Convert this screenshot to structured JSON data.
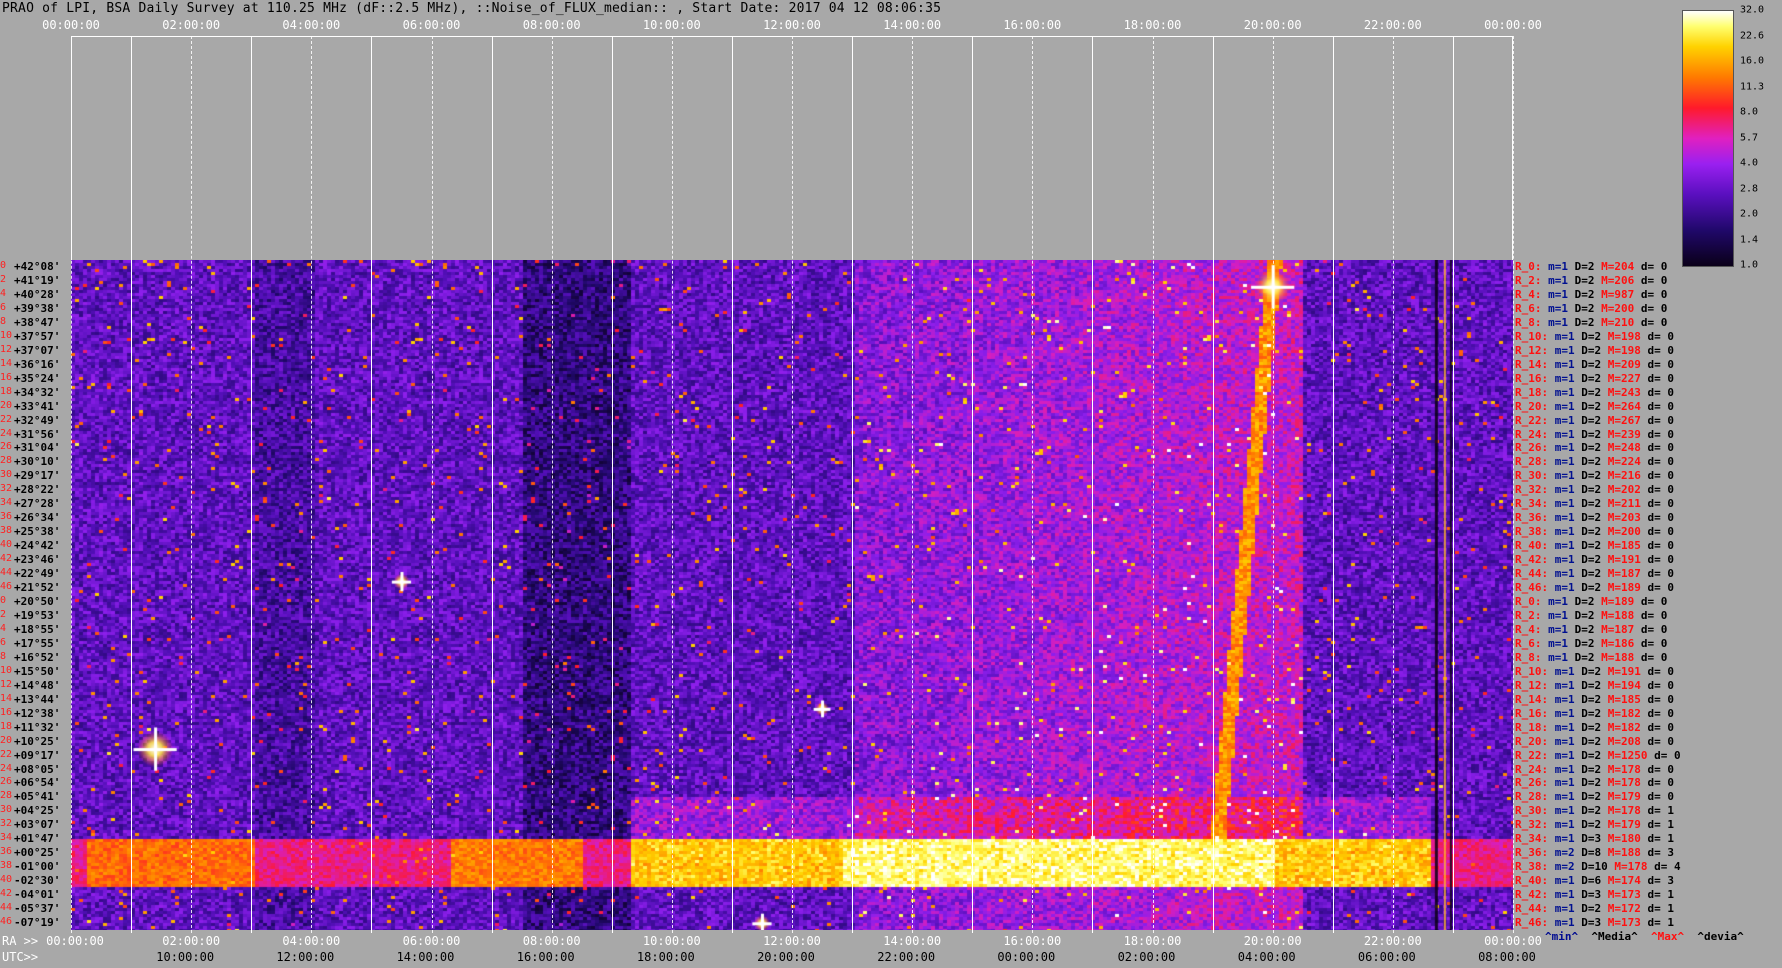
{
  "title": "PRAO of LPI, BSA Daily Survey at 110.25 MHz (dF::2.5 MHz), ::Noise_of_FLUX_median:: , Start Date: 2017 04 12 08:06:35",
  "top_ticks": [
    "00:00:00",
    "02:00:00",
    "04:00:00",
    "06:00:00",
    "08:00:00",
    "10:00:00",
    "12:00:00",
    "14:00:00",
    "16:00:00",
    "18:00:00",
    "20:00:00",
    "22:00:00",
    "00:00:00"
  ],
  "colorbar": {
    "ticks": [
      "32.0",
      "22.6",
      "16.0",
      "11.3",
      "8.0",
      "5.7",
      "4.0",
      "2.8",
      "2.0",
      "1.4",
      "1.0"
    ],
    "colors": [
      "#0a0018",
      "#20086a",
      "#5a0fbf",
      "#9a20f0",
      "#e020c0",
      "#ff1a2a",
      "#ff7a00",
      "#ffd200",
      "#ffff70",
      "#ffffff"
    ]
  },
  "row_index": [
    "0",
    "2",
    "4",
    "6",
    "8",
    "10",
    "12",
    "14",
    "16",
    "18",
    "20",
    "22",
    "24",
    "26",
    "28",
    "30",
    "32",
    "34",
    "36",
    "38",
    "40",
    "42",
    "44",
    "46",
    "0",
    "2",
    "4",
    "6",
    "8",
    "10",
    "12",
    "14",
    "16",
    "18",
    "20",
    "22",
    "24",
    "26",
    "28",
    "30",
    "32",
    "34",
    "36",
    "38",
    "40",
    "42",
    "44",
    "46"
  ],
  "declinations": [
    "+42°08'",
    "+41°19'",
    "+40°28'",
    "+39°38'",
    "+38°47'",
    "+37°57'",
    "+37°07'",
    "+36°16'",
    "+35°24'",
    "+34°32'",
    "+33°41'",
    "+32°49'",
    "+31°56'",
    "+31°04'",
    "+30°10'",
    "+29°17'",
    "+28°22'",
    "+27°28'",
    "+26°34'",
    "+25°38'",
    "+24°42'",
    "+23°46'",
    "+22°49'",
    "+21°52'",
    "+20°50'",
    "+19°53'",
    "+18°55'",
    "+17°55'",
    "+16°52'",
    "+15°50'",
    "+14°48'",
    "+13°44'",
    "+12°38'",
    "+11°32'",
    "+10°25'",
    "+09°17'",
    "+08°05'",
    "+06°54'",
    "+05°41'",
    "+04°25'",
    "+03°07'",
    "+01°47'",
    "+00°25'",
    "-01°00'",
    "-02°30'",
    "-04°01'",
    "-05°37'",
    "-07°19'"
  ],
  "right_labels": [
    {
      "r": "R_0:",
      "m": "m=1",
      "D": "D=2",
      "M": "M=204",
      "d": "d= 0"
    },
    {
      "r": "R_2:",
      "m": "m=1",
      "D": "D=2",
      "M": "M=206",
      "d": "d= 0"
    },
    {
      "r": "R_4:",
      "m": "m=1",
      "D": "D=2",
      "M": "M=987",
      "d": "d= 0"
    },
    {
      "r": "R_6:",
      "m": "m=1",
      "D": "D=2",
      "M": "M=200",
      "d": "d= 0"
    },
    {
      "r": "R_8:",
      "m": "m=1",
      "D": "D=2",
      "M": "M=210",
      "d": "d= 0"
    },
    {
      "r": "R_10:",
      "m": "m=1",
      "D": "D=2",
      "M": "M=198",
      "d": "d= 0"
    },
    {
      "r": "R_12:",
      "m": "m=1",
      "D": "D=2",
      "M": "M=198",
      "d": "d= 0"
    },
    {
      "r": "R_14:",
      "m": "m=1",
      "D": "D=2",
      "M": "M=209",
      "d": "d= 0"
    },
    {
      "r": "R_16:",
      "m": "m=1",
      "D": "D=2",
      "M": "M=227",
      "d": "d= 0"
    },
    {
      "r": "R_18:",
      "m": "m=1",
      "D": "D=2",
      "M": "M=243",
      "d": "d= 0"
    },
    {
      "r": "R_20:",
      "m": "m=1",
      "D": "D=2",
      "M": "M=264",
      "d": "d= 0"
    },
    {
      "r": "R_22:",
      "m": "m=1",
      "D": "D=2",
      "M": "M=267",
      "d": "d= 0"
    },
    {
      "r": "R_24:",
      "m": "m=1",
      "D": "D=2",
      "M": "M=239",
      "d": "d= 0"
    },
    {
      "r": "R_26:",
      "m": "m=1",
      "D": "D=2",
      "M": "M=248",
      "d": "d= 0"
    },
    {
      "r": "R_28:",
      "m": "m=1",
      "D": "D=2",
      "M": "M=224",
      "d": "d= 0"
    },
    {
      "r": "R_30:",
      "m": "m=1",
      "D": "D=2",
      "M": "M=216",
      "d": "d= 0"
    },
    {
      "r": "R_32:",
      "m": "m=1",
      "D": "D=2",
      "M": "M=202",
      "d": "d= 0"
    },
    {
      "r": "R_34:",
      "m": "m=1",
      "D": "D=2",
      "M": "M=211",
      "d": "d= 0"
    },
    {
      "r": "R_36:",
      "m": "m=1",
      "D": "D=2",
      "M": "M=203",
      "d": "d= 0"
    },
    {
      "r": "R_38:",
      "m": "m=1",
      "D": "D=2",
      "M": "M=200",
      "d": "d= 0"
    },
    {
      "r": "R_40:",
      "m": "m=1",
      "D": "D=2",
      "M": "M=185",
      "d": "d= 0"
    },
    {
      "r": "R_42:",
      "m": "m=1",
      "D": "D=2",
      "M": "M=191",
      "d": "d= 0"
    },
    {
      "r": "R_44:",
      "m": "m=1",
      "D": "D=2",
      "M": "M=187",
      "d": "d= 0"
    },
    {
      "r": "R_46:",
      "m": "m=1",
      "D": "D=2",
      "M": "M=189",
      "d": "d= 0"
    },
    {
      "r": "R_0:",
      "m": "m=1",
      "D": "D=2",
      "M": "M=189",
      "d": "d= 0"
    },
    {
      "r": "R_2:",
      "m": "m=1",
      "D": "D=2",
      "M": "M=188",
      "d": "d= 0"
    },
    {
      "r": "R_4:",
      "m": "m=1",
      "D": "D=2",
      "M": "M=187",
      "d": "d= 0"
    },
    {
      "r": "R_6:",
      "m": "m=1",
      "D": "D=2",
      "M": "M=186",
      "d": "d= 0"
    },
    {
      "r": "R_8:",
      "m": "m=1",
      "D": "D=2",
      "M": "M=188",
      "d": "d= 0"
    },
    {
      "r": "R_10:",
      "m": "m=1",
      "D": "D=2",
      "M": "M=191",
      "d": "d= 0"
    },
    {
      "r": "R_12:",
      "m": "m=1",
      "D": "D=2",
      "M": "M=194",
      "d": "d= 0"
    },
    {
      "r": "R_14:",
      "m": "m=1",
      "D": "D=2",
      "M": "M=185",
      "d": "d= 0"
    },
    {
      "r": "R_16:",
      "m": "m=1",
      "D": "D=2",
      "M": "M=182",
      "d": "d= 0"
    },
    {
      "r": "R_18:",
      "m": "m=1",
      "D": "D=2",
      "M": "M=182",
      "d": "d= 0"
    },
    {
      "r": "R_20:",
      "m": "m=1",
      "D": "D=2",
      "M": "M=208",
      "d": "d= 0"
    },
    {
      "r": "R_22:",
      "m": "m=1",
      "D": "D=2",
      "M": "M=1250",
      "d": "d= 0"
    },
    {
      "r": "R_24:",
      "m": "m=1",
      "D": "D=2",
      "M": "M=178",
      "d": "d= 0"
    },
    {
      "r": "R_26:",
      "m": "m=1",
      "D": "D=2",
      "M": "M=178",
      "d": "d= 0"
    },
    {
      "r": "R_28:",
      "m": "m=1",
      "D": "D=2",
      "M": "M=179",
      "d": "d= 0"
    },
    {
      "r": "R_30:",
      "m": "m=1",
      "D": "D=2",
      "M": "M=178",
      "d": "d= 1"
    },
    {
      "r": "R_32:",
      "m": "m=1",
      "D": "D=2",
      "M": "M=179",
      "d": "d= 1"
    },
    {
      "r": "R_34:",
      "m": "m=1",
      "D": "D=3",
      "M": "M=180",
      "d": "d= 1"
    },
    {
      "r": "R_36:",
      "m": "m=2",
      "D": "D=8",
      "M": "M=188",
      "d": "d= 3"
    },
    {
      "r": "R_38:",
      "m": "m=2",
      "D": "D=10",
      "M": "M=178",
      "d": "d= 4"
    },
    {
      "r": "R_40:",
      "m": "m=1",
      "D": "D=6",
      "M": "M=174",
      "d": "d= 3"
    },
    {
      "r": "R_42:",
      "m": "m=1",
      "D": "D=3",
      "M": "M=173",
      "d": "d= 1"
    },
    {
      "r": "R_44:",
      "m": "m=1",
      "D": "D=2",
      "M": "M=172",
      "d": "d= 1"
    },
    {
      "r": "R_46:",
      "m": "m=1",
      "D": "D=3",
      "M": "M=173",
      "d": "d= 1"
    }
  ],
  "ra_label": "RA >>",
  "utc_label": "UTC>>",
  "ra_ticks": [
    "00:00:00",
    "02:00:00",
    "04:00:00",
    "06:00:00",
    "08:00:00",
    "10:00:00",
    "12:00:00",
    "14:00:00",
    "16:00:00",
    "18:00:00",
    "20:00:00",
    "22:00:00",
    "00:00:00"
  ],
  "utc_ticks": [
    "10:00:00",
    "12:00:00",
    "14:00:00",
    "16:00:00",
    "18:00:00",
    "20:00:00",
    "22:00:00",
    "00:00:00",
    "02:00:00",
    "04:00:00",
    "06:00:00",
    "08:00:00"
  ],
  "legend": {
    "min": "^min^",
    "media": "^Media^",
    "max": "^Max^",
    "devia": "^devia^"
  }
}
